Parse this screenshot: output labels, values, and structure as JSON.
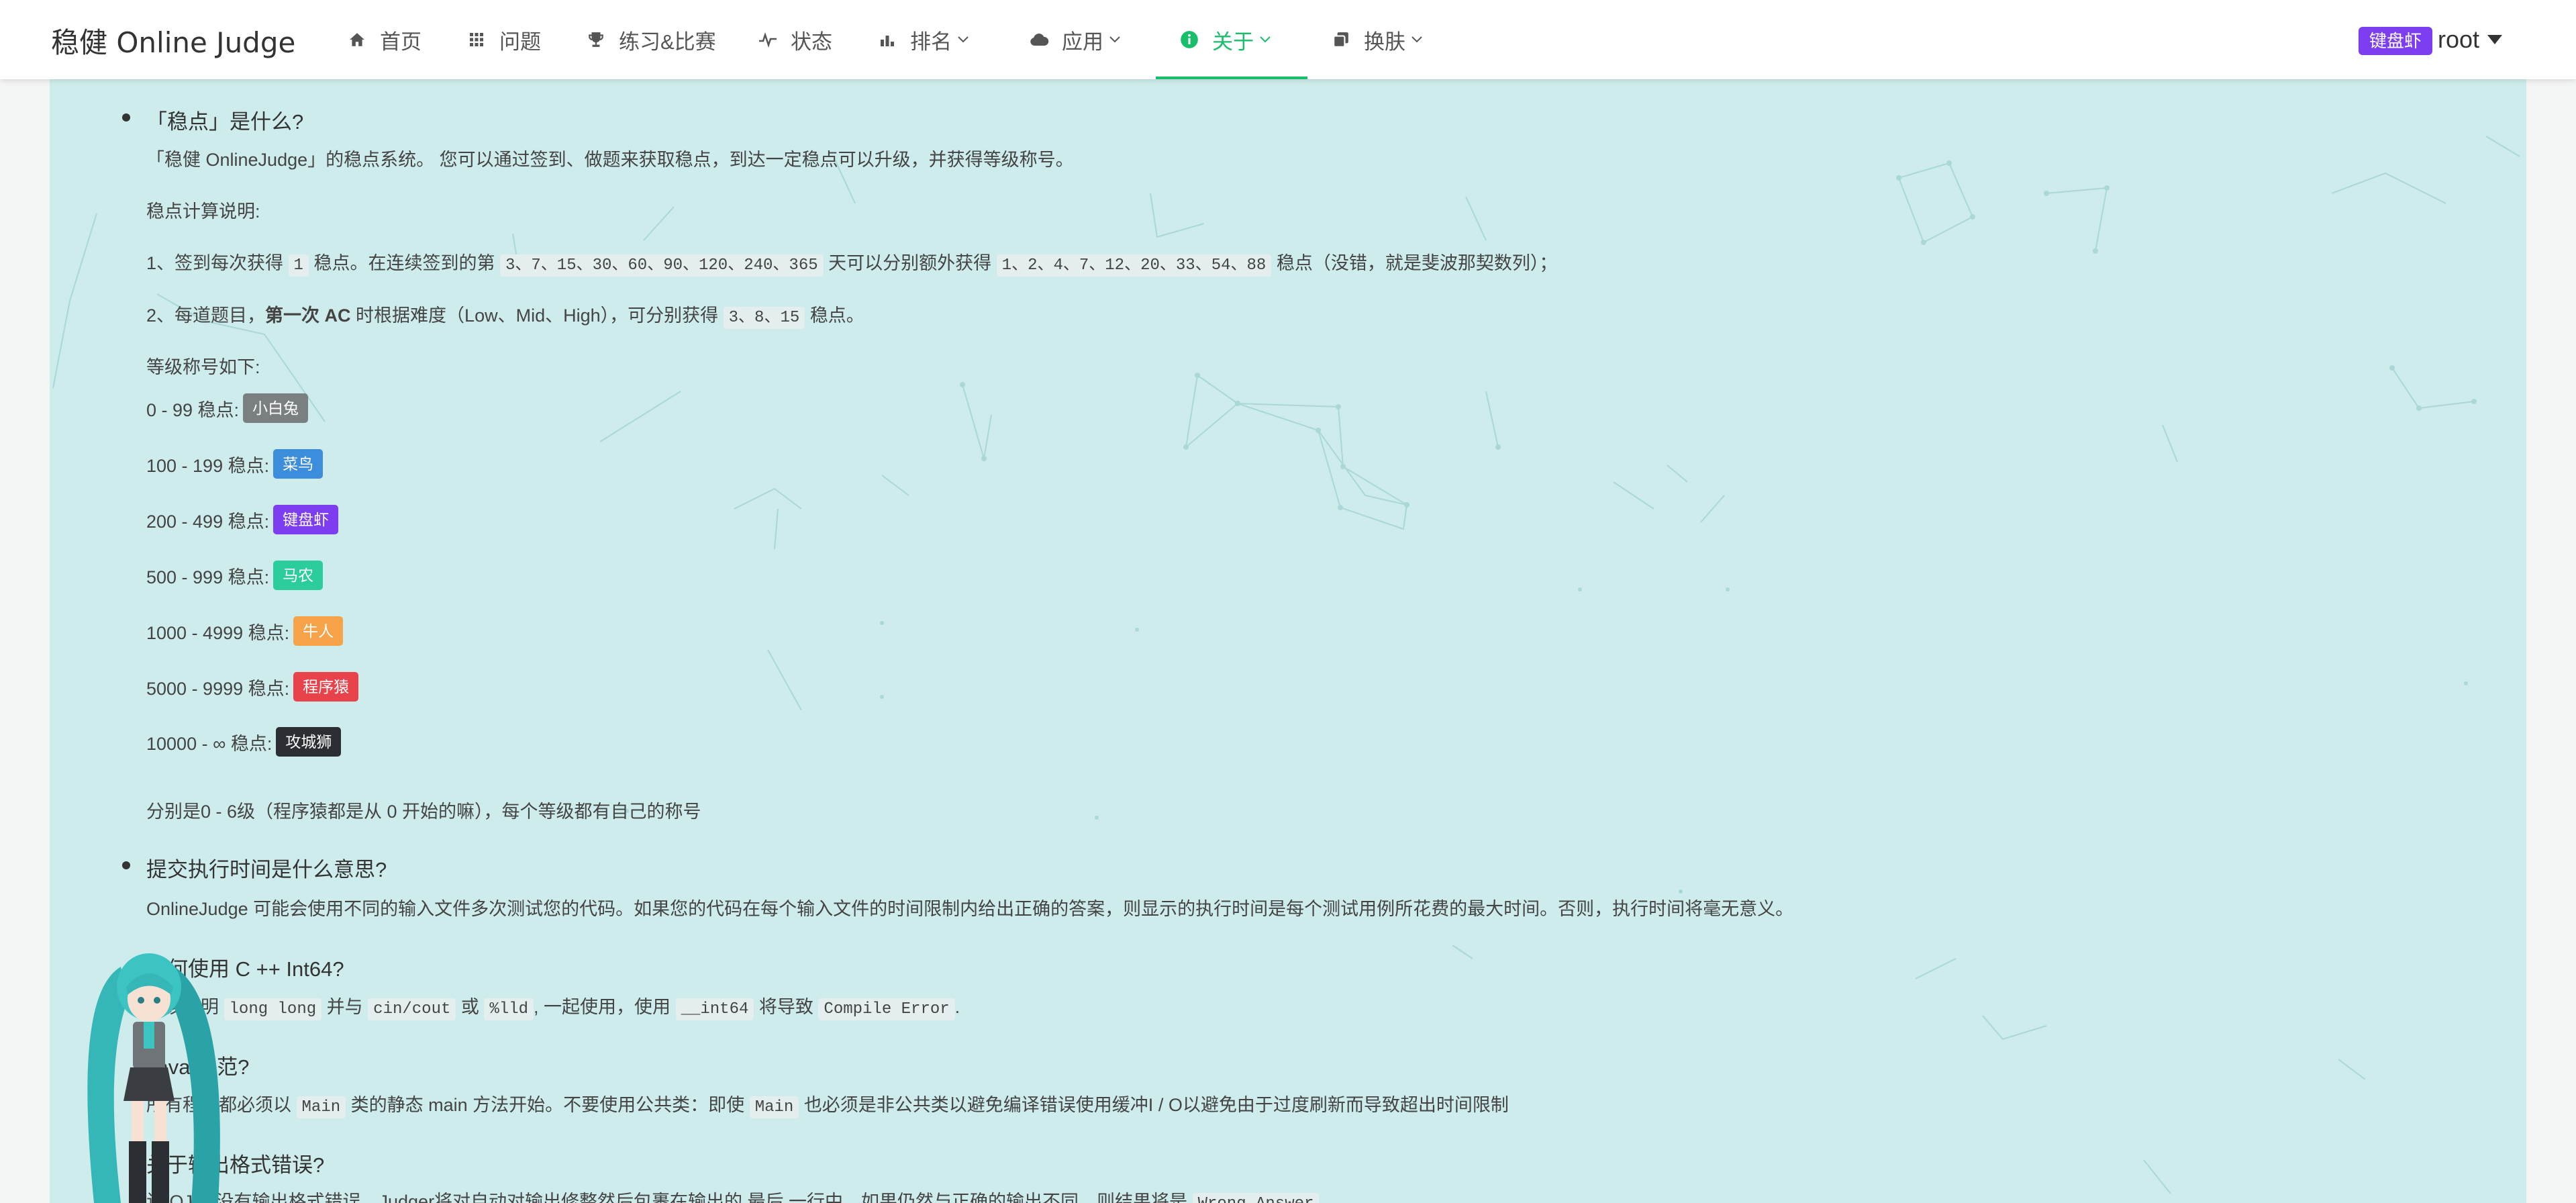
{
  "nav": {
    "brand": "稳健 Online Judge",
    "items": [
      {
        "label": "首页",
        "icon": "home-icon"
      },
      {
        "label": "问题",
        "icon": "grid-icon"
      },
      {
        "label": "练习&比赛",
        "icon": "trophy-icon"
      },
      {
        "label": "状态",
        "icon": "pulse-icon"
      },
      {
        "label": "排名",
        "icon": "bar-chart-icon",
        "dropdown": true
      },
      {
        "label": "应用",
        "icon": "cloud-icon",
        "dropdown": true
      },
      {
        "label": "关于",
        "icon": "info-icon",
        "dropdown": true,
        "active": true
      },
      {
        "label": "换肤",
        "icon": "copy-icon",
        "dropdown": true
      }
    ],
    "user_badge": "键盘虾",
    "user_name": "root",
    "accent": "#19be6b"
  },
  "faq": {
    "q1": {
      "title": "「稳点」是什么?",
      "intro": "「稳健 OnlineJudge」的稳点系统。 您可以通过签到、做题来获取稳点，到达一定稳点可以升级，并获得等级称号。",
      "calc_label": "稳点计算说明:",
      "rule1_a": "1、签到每次获得",
      "rule1_code1": "1",
      "rule1_b": "稳点。在连续签到的第",
      "rule1_code2": "3、7、15、30、60、90、120、240、365",
      "rule1_c": "天可以分别额外获得",
      "rule1_code3": "1、2、4、7、12、20、33、54、88",
      "rule1_d": "稳点（没错，就是斐波那契数列）；",
      "rule2_a": "2、每道题目，",
      "rule2_bold": "第一次 AC",
      "rule2_b": "时根据难度（Low、Mid、High），可分别获得",
      "rule2_code": "3、8、15",
      "rule2_c": "稳点。",
      "levels_label": "等级称号如下:",
      "levels": [
        {
          "range": "0 - 99 稳点:",
          "title": "小白兔",
          "color": "#7a7f82"
        },
        {
          "range": "100 - 199 稳点:",
          "title": "菜鸟",
          "color": "#3c8ddb"
        },
        {
          "range": "200 - 499 稳点:",
          "title": "键盘虾",
          "color": "#7d3df0"
        },
        {
          "range": "500 - 999 稳点:",
          "title": "马农",
          "color": "#2ccd9c"
        },
        {
          "range": "1000 - 4999 稳点:",
          "title": "牛人",
          "color": "#f7a34a"
        },
        {
          "range": "5000 - 9999 稳点:",
          "title": "程序猿",
          "color": "#e8434b"
        },
        {
          "range": "10000 - ∞ 稳点:",
          "title": "攻城狮",
          "color": "#2b2f33"
        }
      ],
      "levels_note": "分别是0 - 6级（程序猿都是从 0 开始的嘛），每个等级都有自己的称号"
    },
    "q2": {
      "title": "提交执行时间是什么意思?",
      "text": "OnlineJudge 可能会使用不同的输入文件多次测试您的代码。如果您的代码在每个输入文件的时间限制内给出正确的答案，则显示的执行时间是每个测试用例所花费的最大时间。否则，执行时间将毫无意义。"
    },
    "q3": {
      "title": "如何使用 C ++ Int64?",
      "a": "应该声明",
      "code1": "long long",
      "b": "并与",
      "code2": "cin/cout",
      "c": "或",
      "code3": "%lld",
      "d": ", 一起使用，使用",
      "code4": "__int64",
      "e": "将导致",
      "code5": "Compile Error",
      "f": "."
    },
    "q4": {
      "title": "Java 规范?",
      "a": "所有程序都必须以",
      "code1": "Main",
      "b": "类的静态 main 方法开始。不要使用公共类：即使",
      "code2": "Main",
      "c": "也必须是非公共类以避免编译错误使用缓冲I / O以避免由于过度刷新而导致超出时间限制"
    },
    "q5": {
      "title": "关于输出格式错误?",
      "a": "该 OJ 中没有输出格式错误。Judger将对自动对输出修整然后包裹在输出的 最后 一行中，如果仍然与正确的输出不同，则结果将是",
      "code1": "Wrong Answer"
    }
  }
}
